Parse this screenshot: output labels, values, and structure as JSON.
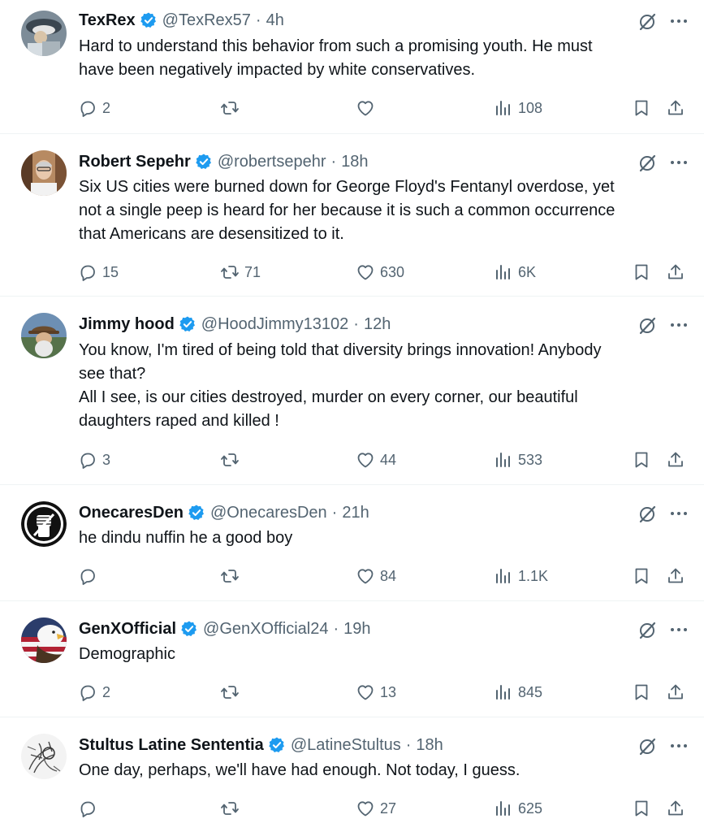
{
  "tweets": [
    {
      "name": "TexRex",
      "handle": "@TexRex57",
      "separator": "·",
      "time": "4h",
      "lines": [
        "Hard to understand this behavior from such a promising youth. He must",
        "have been negatively impacted by white conservatives."
      ],
      "replies": "2",
      "retweets": "",
      "likes": "",
      "views": "108"
    },
    {
      "name": "Robert Sepehr",
      "handle": "@robertsepehr",
      "separator": "·",
      "time": "18h",
      "lines": [
        "Six US cities were burned down for George Floyd's Fentanyl overdose, yet",
        "not a single peep is heard for her because it is such a common occurrence",
        "that Americans are desensitized to it."
      ],
      "replies": "15",
      "retweets": "71",
      "likes": "630",
      "views": "6K"
    },
    {
      "name": "Jimmy hood",
      "handle": "@HoodJimmy13102",
      "separator": "·",
      "time": "12h",
      "lines": [
        "You know, I'm tired of being told that diversity brings innovation! Anybody",
        "see that?",
        "All I see, is our cities destroyed, murder on every corner,  our beautiful",
        "daughters raped and killed !"
      ],
      "replies": "3",
      "retweets": "",
      "likes": "44",
      "views": "533"
    },
    {
      "name": "OnecaresDen",
      "handle": "@OnecaresDen",
      "separator": "·",
      "time": "21h",
      "lines": [
        "he dindu nuffin he a good boy"
      ],
      "replies": "",
      "retweets": "",
      "likes": "84",
      "views": "1.1K"
    },
    {
      "name": "GenXOfficial",
      "handle": "@GenXOfficial24",
      "separator": "·",
      "time": "19h",
      "lines": [
        "Demographic"
      ],
      "replies": "2",
      "retweets": "",
      "likes": "13",
      "views": "845"
    },
    {
      "name": "Stultus Latine Sententia",
      "handle": "@LatineStultus",
      "separator": "·",
      "time": "18h",
      "lines": [
        "One day, perhaps, we'll have had enough. Not today, I guess."
      ],
      "replies": "",
      "retweets": "",
      "likes": "27",
      "views": "625"
    }
  ],
  "icons": {
    "verified": "verified-badge-icon",
    "grok": "grok-icon",
    "more": "more-options-icon",
    "reply": "reply-icon",
    "retweet": "retweet-icon",
    "like": "like-icon",
    "views": "views-icon",
    "bookmark": "bookmark-icon",
    "share": "share-icon"
  },
  "colors": {
    "text": "#0f1419",
    "secondary": "#536471",
    "verified": "#1d9bf0",
    "divider": "#eff3f4"
  }
}
